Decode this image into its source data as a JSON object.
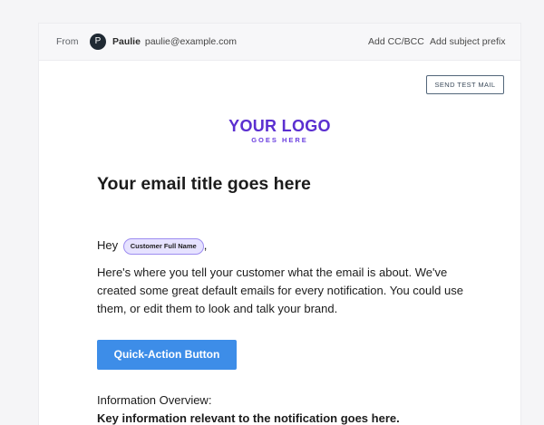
{
  "header": {
    "from_label": "From",
    "avatar_letter": "P",
    "sender_name": "Paulie",
    "sender_email": "paulie@example.com",
    "add_cc_bcc": "Add CC/BCC",
    "add_subject_prefix": "Add subject prefix"
  },
  "toolbar": {
    "send_test_mail": "SEND TEST MAIL"
  },
  "logo": {
    "main": "YOUR LOGO",
    "sub": "GOES HERE"
  },
  "email": {
    "title": "Your email title goes here",
    "greeting_prefix": "Hey",
    "customer_token": "Customer Full Name",
    "greeting_suffix": ",",
    "body": "Here's where you tell your customer what the email is about. We've created some great default emails for every notification. You could use them, or edit them to look and talk your brand.",
    "action_button": "Quick-Action Button",
    "info_label": "Information Overview:",
    "info_value": "Key information relevant to the notification goes here."
  },
  "colors": {
    "background": "#f5f5f7",
    "logo": "#5b2fd0",
    "token_fill": "#e6e2ff",
    "token_border": "#9d8df0",
    "action_button": "#3d8de8",
    "avatar": "#1f2933"
  }
}
